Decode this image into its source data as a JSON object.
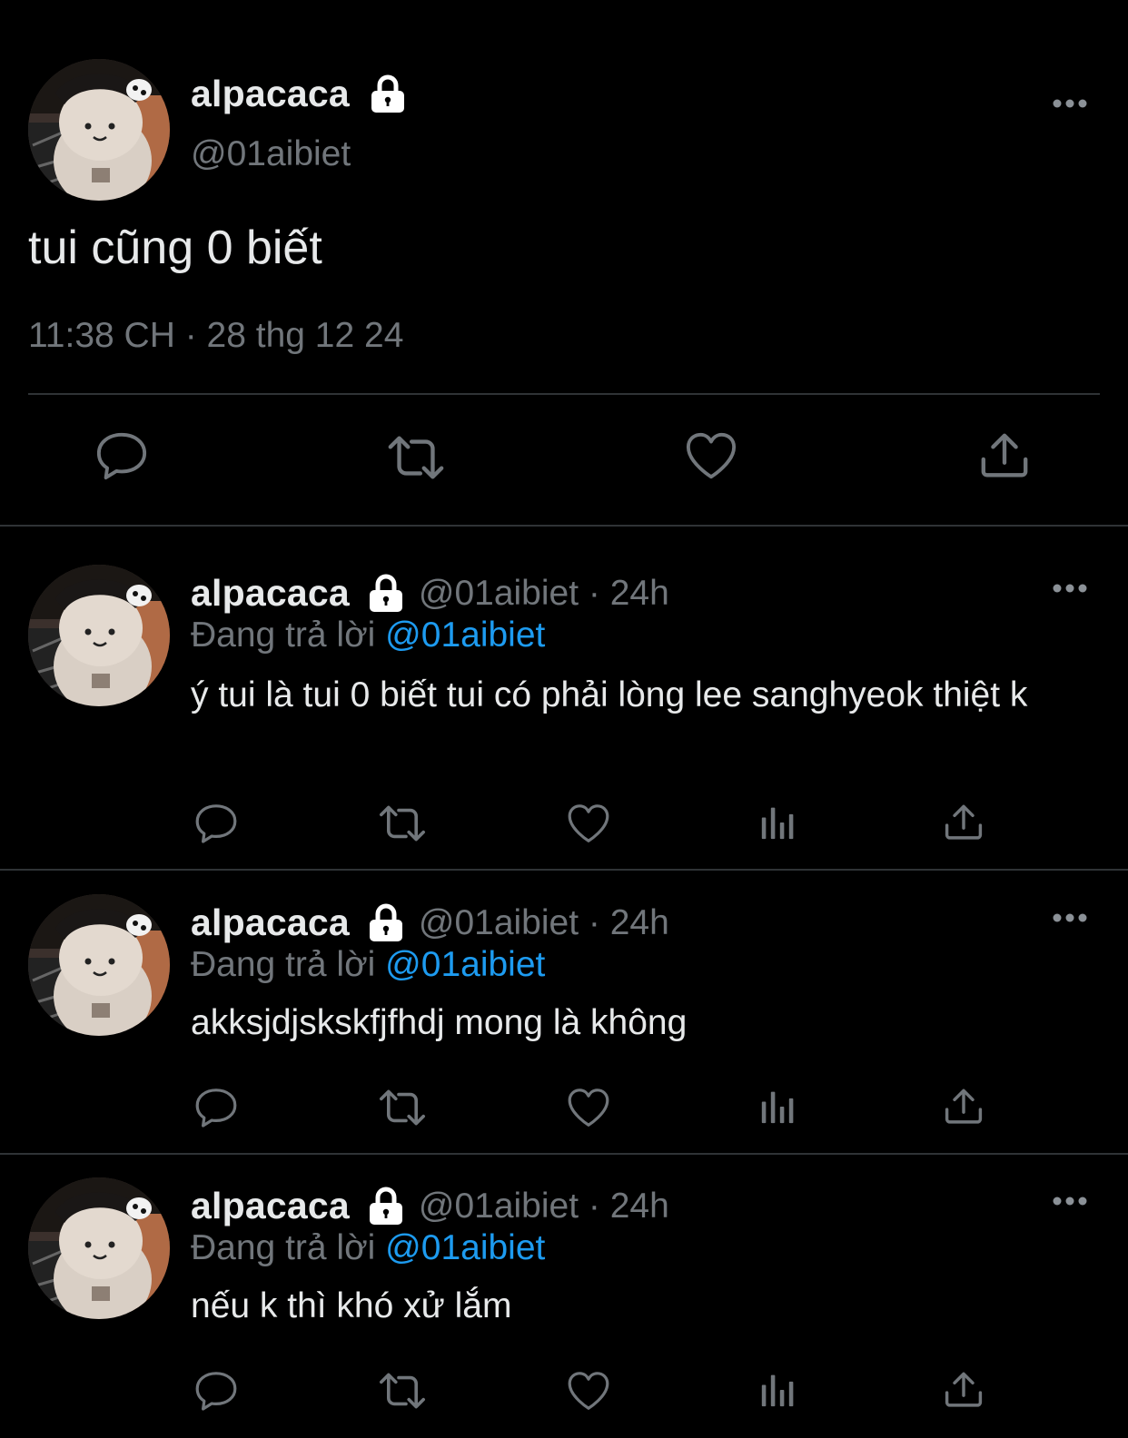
{
  "main_tweet": {
    "display_name": "alpacaca",
    "handle": "@01aibiet",
    "text": "tui cũng 0 biết",
    "timestamp": "11:38 CH · 28 thg 12 24",
    "icons": [
      "lock-icon",
      "more-icon",
      "reply-icon",
      "retweet-icon",
      "like-icon",
      "share-icon"
    ]
  },
  "replies": [
    {
      "display_name": "alpacaca",
      "meta": "@01aibiet · 24h",
      "replying_prefix": "Đang trả lời",
      "replying_to": "@01aibiet",
      "text": "ý tui là tui 0 biết tui có phải lòng lee sanghyeok thiệt k"
    },
    {
      "display_name": "alpacaca",
      "meta": "@01aibiet · 24h",
      "replying_prefix": "Đang trả lời",
      "replying_to": "@01aibiet",
      "text": "akksjdjskskfjfhdj mong là không"
    },
    {
      "display_name": "alpacaca",
      "meta": "@01aibiet · 24h",
      "replying_prefix": "Đang trả lời",
      "replying_to": "@01aibiet",
      "text": "nếu k thì khó xử lắm"
    }
  ],
  "colors": {
    "background": "#000000",
    "text": "#e7e9ea",
    "secondary": "#71767b",
    "mention": "#1d9bf0",
    "divider": "#2f3336"
  }
}
